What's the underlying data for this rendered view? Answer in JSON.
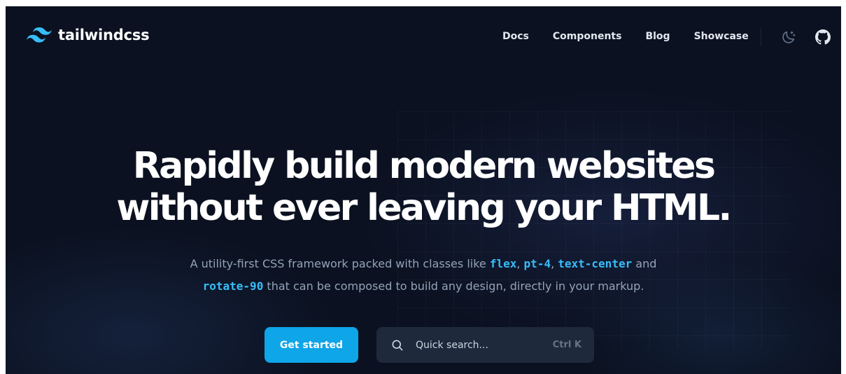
{
  "header": {
    "logo_text": "tailwindcss",
    "nav": [
      {
        "label": "Docs"
      },
      {
        "label": "Components"
      },
      {
        "label": "Blog"
      },
      {
        "label": "Showcase"
      }
    ],
    "icons": [
      "theme-toggle-icon",
      "github-icon"
    ]
  },
  "hero": {
    "title_line1": "Rapidly build modern websites",
    "title_line2": "without ever leaving your HTML.",
    "subtitle": {
      "text1": "A utility-first CSS framework packed with classes like ",
      "code1": "flex",
      "text2": ", ",
      "code2": "pt-4",
      "text3": ", ",
      "code3": "text-center",
      "text4": " and",
      "code4": "rotate-90",
      "text5": " that can be composed to build any design, directly in your markup."
    }
  },
  "actions": {
    "primary_label": "Get started",
    "search_placeholder": "Quick search...",
    "search_shortcut": "Ctrl K"
  },
  "colors": {
    "background": "#0b1120",
    "accent": "#0ea5e9",
    "code": "#38bdf8",
    "muted_text": "#94a3b8",
    "search_bg": "#1e293b"
  }
}
